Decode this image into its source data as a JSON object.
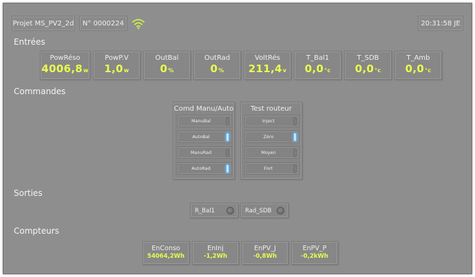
{
  "header": {
    "project": "Projet MS_PV2_2d",
    "serial": "N° 0000224",
    "clock": "20:31:58 JE",
    "wifi_icon": "wifi-icon",
    "wifi_color": "#c8e84a"
  },
  "sections": {
    "inputs": "Entrées",
    "commands": "Commandes",
    "outputs": "Sorties",
    "counters": "Compteurs"
  },
  "inputs": [
    {
      "label": "PowRéso",
      "value": "4006,8",
      "unit": "w"
    },
    {
      "label": "PowP.V",
      "value": "1,0",
      "unit": "w"
    },
    {
      "label": "OutBal",
      "value": "0",
      "unit": "%"
    },
    {
      "label": "OutRad",
      "value": "0",
      "unit": "%"
    },
    {
      "label": "VoltRés",
      "value": "211,4",
      "unit": "v"
    },
    {
      "label": "T_Bal1",
      "value": "0,0",
      "unit": "°c"
    },
    {
      "label": "T_SDB",
      "value": "0,0",
      "unit": "°c"
    },
    {
      "label": "T_Amb",
      "value": "0,0",
      "unit": "°c"
    }
  ],
  "commands": {
    "manual_auto": {
      "title": "Comd Manu/Auto",
      "rows": [
        {
          "label": "ManuBal",
          "on": false
        },
        {
          "label": "AutoBal",
          "on": true
        },
        {
          "label": "ManuRad",
          "on": false
        },
        {
          "label": "AutoRad",
          "on": true
        }
      ]
    },
    "router_test": {
      "title": "Test routeur",
      "rows": [
        {
          "label": "Inject",
          "on": false
        },
        {
          "label": "Zéro",
          "on": true
        },
        {
          "label": "Moyen",
          "on": false
        },
        {
          "label": "Fort",
          "on": false
        }
      ]
    }
  },
  "outputs": [
    {
      "label": "R_Bal1",
      "state": "off"
    },
    {
      "label": "Rad_SDB",
      "state": "off"
    }
  ],
  "counters": [
    {
      "label": "EnConso",
      "value": "54064,2Wh"
    },
    {
      "label": "EnInj",
      "value": "-1,2Wh"
    },
    {
      "label": "EnPV_J",
      "value": "-0,8Wh"
    },
    {
      "label": "EnPV_P",
      "value": "-0,2kWh"
    }
  ],
  "colors": {
    "background": "#8e8e8e",
    "value_text": "#eafc4e",
    "switch_on": "#bfe8ff"
  }
}
